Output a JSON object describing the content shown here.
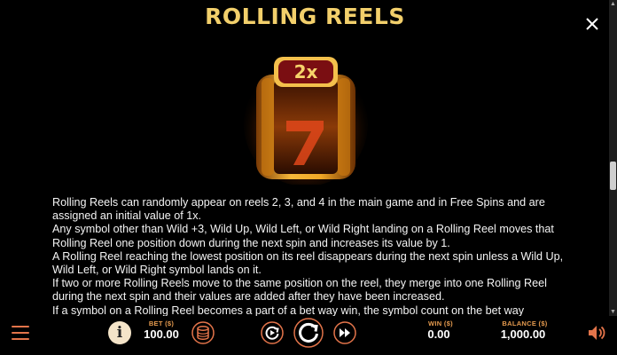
{
  "title": "ROLLING REELS",
  "multiplier_badge": "2x",
  "paragraphs": [
    "Rolling Reels can randomly appear on reels 2, 3, and 4 in the main game and in Free Spins and are assigned an initial value of 1x.",
    "Any symbol other than Wild +3, Wild Up, Wild Left, or Wild Right landing on a Rolling Reel moves that Rolling Reel one position down during the next spin and increases its value by 1.",
    "A Rolling Reel reaching the lowest position on its reel disappears during the next spin unless a Wild Up, Wild Left, or Wild Right symbol lands on it.",
    "If two or more Rolling Reels move to the same position on the reel, they merge into one Rolling Reel during the next spin and their values are added after they have been increased.",
    "If a symbol on a Rolling Reel becomes a part of a bet way win, the symbol count on the bet way"
  ],
  "bottom_bar": {
    "bet_label": "BET ($)",
    "bet_value": "100.00",
    "win_label": "WIN ($)",
    "win_value": "0.00",
    "balance_label": "BALANCE ($)",
    "balance_value": "1,000.00",
    "info_symbol": "i"
  },
  "icons": {
    "menu": "hamburger-menu-icon",
    "info": "info-icon",
    "coins": "coin-stack-icon",
    "autoplay": "autoplay-icon",
    "spin": "spin-icon",
    "turbo": "fast-forward-icon",
    "sound": "speaker-icon",
    "close": "close-icon"
  },
  "colors": {
    "title": "#f2cf6b",
    "accent": "#e3744a",
    "label": "#e49a4e"
  }
}
